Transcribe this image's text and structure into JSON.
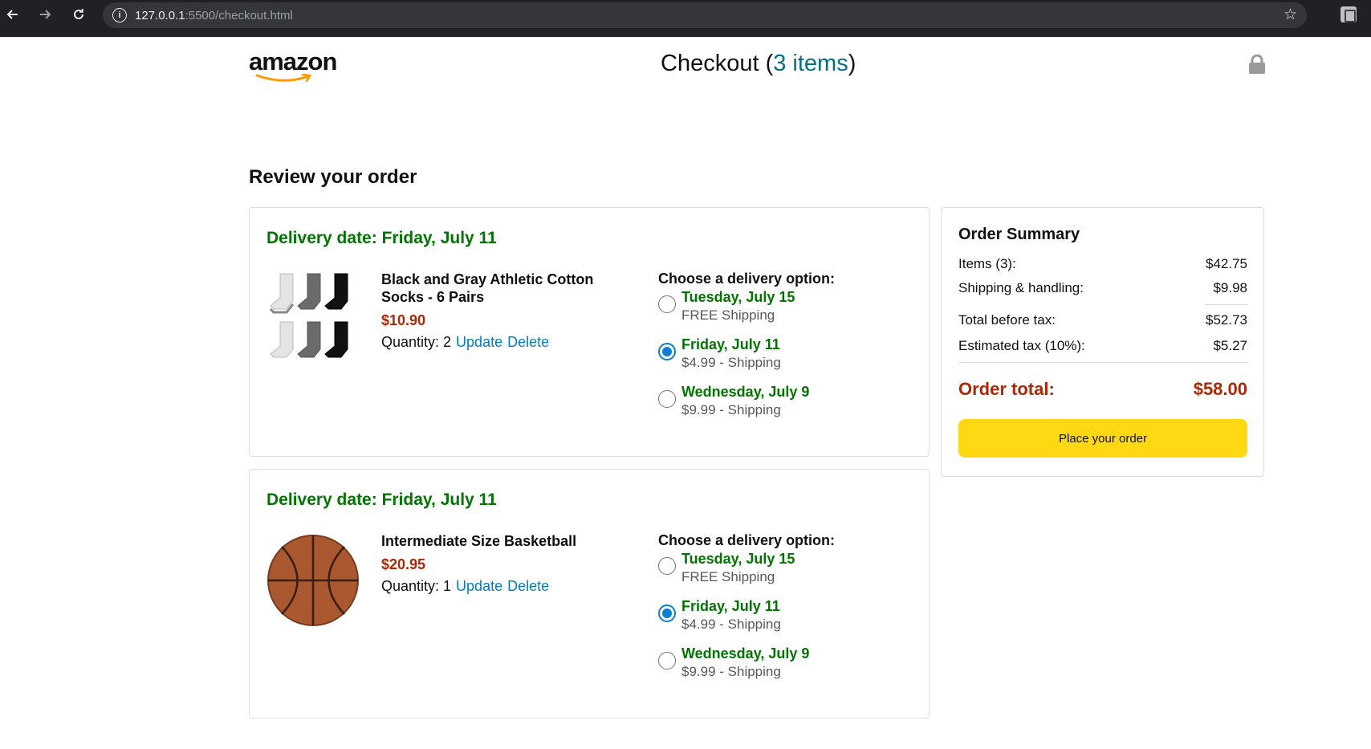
{
  "browser": {
    "url_host": "127.0.0.1",
    "url_path": ":5500/checkout.html"
  },
  "header": {
    "logo_text": "amazon",
    "title_prefix": "Checkout (",
    "items_link": "3 items",
    "title_suffix": ")"
  },
  "page": {
    "title": "Review your order"
  },
  "orders": [
    {
      "delivery_date": "Delivery date: Friday, July 11",
      "product_name": "Black and Gray Athletic Cotton Socks - 6 Pairs",
      "price": "$10.90",
      "quantity_label": "Quantity: 2",
      "update": "Update",
      "delete": "Delete",
      "options_title": "Choose a delivery option:",
      "options": [
        {
          "date": "Tuesday, July 15",
          "price": "FREE Shipping",
          "selected": false
        },
        {
          "date": "Friday, July 11",
          "price": "$4.99 - Shipping",
          "selected": true
        },
        {
          "date": "Wednesday, July 9",
          "price": "$9.99 - Shipping",
          "selected": false
        }
      ]
    },
    {
      "delivery_date": "Delivery date: Friday, July 11",
      "product_name": "Intermediate Size Basketball",
      "price": "$20.95",
      "quantity_label": "Quantity: 1",
      "update": "Update",
      "delete": "Delete",
      "options_title": "Choose a delivery option:",
      "options": [
        {
          "date": "Tuesday, July 15",
          "price": "FREE Shipping",
          "selected": false
        },
        {
          "date": "Friday, July 11",
          "price": "$4.99 - Shipping",
          "selected": true
        },
        {
          "date": "Wednesday, July 9",
          "price": "$9.99 - Shipping",
          "selected": false
        }
      ]
    }
  ],
  "summary": {
    "title": "Order Summary",
    "items_label": "Items (3):",
    "items_value": "$42.75",
    "shipping_label": "Shipping & handling:",
    "shipping_value": "$9.98",
    "before_tax_label": "Total before tax:",
    "before_tax_value": "$52.73",
    "tax_label": "Estimated tax (10%):",
    "tax_value": "$5.27",
    "total_label": "Order total:",
    "total_value": "$58.00",
    "place_order": "Place your order"
  },
  "colors": {
    "delivery_green": "#007600",
    "price_red": "#b12704",
    "link_blue": "#017cc2",
    "button_yellow": "#ffd814",
    "radio_blue": "#0a7fd8"
  }
}
